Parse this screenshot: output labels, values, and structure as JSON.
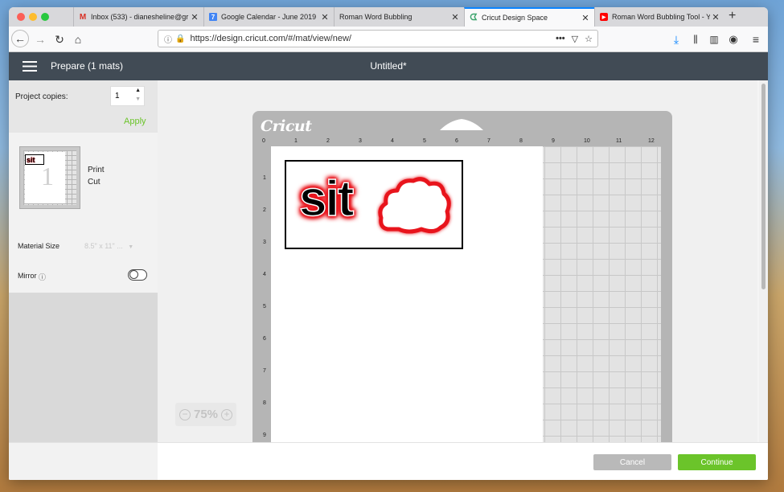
{
  "browser": {
    "tabs": [
      {
        "title": "Inbox (533) - dianesheline@gr",
        "favicon": "gmail-icon"
      },
      {
        "title": "Google Calendar - June 2019",
        "favicon": "calendar-icon",
        "favicon_text": "7"
      },
      {
        "title": "Roman Word Bubbling",
        "favicon": ""
      },
      {
        "title": "Cricut Design Space",
        "favicon": "cricut-icon"
      },
      {
        "title": "Roman Word Bubbling Tool - Y",
        "favicon": "youtube-icon"
      }
    ],
    "url": "https://design.cricut.com/#/mat/view/new/"
  },
  "header": {
    "prepare_label": "Prepare (1 mats)",
    "doc_title": "Untitled*"
  },
  "sidebar": {
    "project_copies_label": "Project copies:",
    "project_copies_value": "1",
    "apply_label": "Apply",
    "mat_number": "1",
    "mat_mode_print": "Print",
    "mat_mode_cut": "Cut",
    "material_size_label": "Material Size",
    "material_size_value": "8.5\" x 11\" ...",
    "mirror_label": "Mirror"
  },
  "canvas": {
    "brand": "Cricut",
    "design_text": "sit",
    "ruler_top": [
      "0",
      "1",
      "2",
      "3",
      "4",
      "5",
      "6",
      "7",
      "8",
      "9",
      "10",
      "11",
      "12"
    ],
    "ruler_left": [
      "1",
      "2",
      "3",
      "4",
      "5",
      "6",
      "7",
      "8",
      "9"
    ],
    "zoom_label": "75%"
  },
  "footer": {
    "cancel_label": "Cancel",
    "continue_label": "Continue"
  },
  "colors": {
    "accent_green": "#6bc42a",
    "header_bg": "#414b55",
    "outline_red": "#e8141c"
  }
}
